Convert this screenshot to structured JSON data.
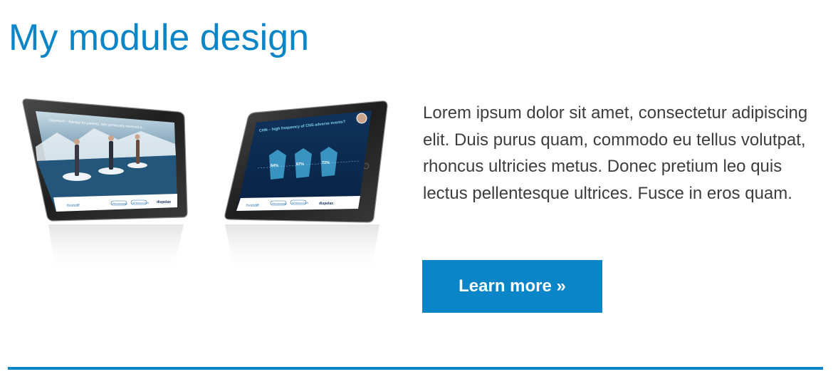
{
  "module": {
    "title": "My module design",
    "body": "Lorem ipsum dolor sit amet, consectetur adipiscing elit. Duis purus quam, commodo eu tellus volutpat, rhoncus ultricies metus. Donec pretium leo quis lectus pellentesque ultrices. Fusce in eros quam.",
    "cta_label": "Learn more »"
  },
  "image": {
    "left_tablet": {
      "headline": "Dispelax® – therapy for patients, who previously received a...",
      "nav_1": "PROGRAMME",
      "nav_2": "INTRODUCTION",
      "footer_brand_left": "freshdiff",
      "logo_text": "dispelax"
    },
    "right_tablet": {
      "headline": "CHN – high frequency of CNS adverse events?",
      "stat_1": "64%",
      "stat_2": "67%",
      "stat_3": "72%",
      "nav_1": "PROGRAMME",
      "nav_2": "INTRODUCTION",
      "footer_brand_left": "freshdiff",
      "logo_text": "dispelax"
    }
  },
  "colors": {
    "accent": "#0a85c7",
    "text": "#3d3d3d",
    "background": "#ffffff"
  }
}
